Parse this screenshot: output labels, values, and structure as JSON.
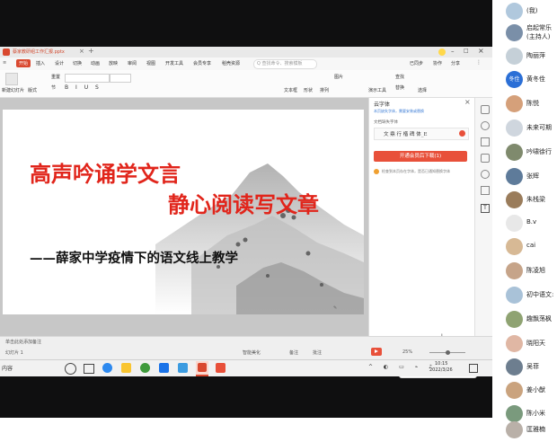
{
  "wps": {
    "doc_tab": "蔡家教研组工作汇报.pptx",
    "menu": [
      "开始",
      "插入",
      "设计",
      "切换",
      "动画",
      "放映",
      "审阅",
      "视图",
      "开发工具",
      "会员专享",
      "稻壳资源"
    ],
    "search_placeholder": "Q 查找命令、搜索模板",
    "menu_right": [
      "已同步",
      "协作",
      "分享"
    ],
    "toolbar_left": [
      "新建幻灯片",
      "版式",
      "重置",
      "节"
    ],
    "toolbar_right": [
      "文本框",
      "形状",
      "排列",
      "图片",
      "查找",
      "替换",
      "演示工具",
      "选择"
    ]
  },
  "slide": {
    "line1": "高声吟诵学文言",
    "line2": "静心阅读写文章",
    "line3": "——薛家中学疫情下的语文线上教学"
  },
  "panel": {
    "title": "云字体",
    "close": "×",
    "hint": "本页缺失字体，需要安装或替换",
    "label": "文档缺失字体",
    "font_name": "方正行楷繁体_E",
    "font_name_display": "文 鼎 行 楷 碑 体_E",
    "install_button": "开通会员后下载(1)",
    "warning": "检查到本页存在字体，是否已通知替换字体"
  },
  "statusbar": {
    "note": "单击此处添加备注",
    "left_label": "幻灯片 1",
    "smart_label": "智能美化",
    "remark_label": "备注",
    "comment_label": "批注",
    "zoom": "25%",
    "lang": "中"
  },
  "taskbar": {
    "search_text": "内容",
    "time": "10:15",
    "date": "2022/3/26"
  },
  "participants": [
    {
      "name": "(我)",
      "color": "#b0c8dd"
    },
    {
      "name": "启起常乐",
      "sub": "(主持人)",
      "color": "#7a8fa8"
    },
    {
      "name": "陶丽萍",
      "color": "#c5d0d8"
    },
    {
      "name": "黄冬佺",
      "color": "#2b6fd6",
      "text": "冬佺"
    },
    {
      "name": "陈悦",
      "color": "#d5a07a"
    },
    {
      "name": "未来可期",
      "color": "#cfd6de"
    },
    {
      "name": "吟啸徐行",
      "color": "#7f8a6d"
    },
    {
      "name": "张辉",
      "color": "#5e7b9a"
    },
    {
      "name": "朱栈梁",
      "color": "#9a7c5b"
    },
    {
      "name": "B.v",
      "color": "#e8e8e8"
    },
    {
      "name": "cai",
      "color": "#d7b995"
    },
    {
      "name": "陈凌旭",
      "color": "#c6a489"
    },
    {
      "name": "初中语文:",
      "color": "#a9c2d8"
    },
    {
      "name": "趣飘荡枫",
      "color": "#8fa372"
    },
    {
      "name": "晓阳天",
      "color": "#e0b7a4"
    },
    {
      "name": "吴菲",
      "color": "#6d7e8f"
    },
    {
      "name": "姜小猷",
      "color": "#caa37e"
    },
    {
      "name": "陈小米",
      "color": "#7a9a7d"
    },
    {
      "name": "匡雅楠",
      "color": "#b9b0a8"
    }
  ],
  "colors": {
    "accent": "#d9482f",
    "slide_title": "#e1251b",
    "install_button": "#e8503a"
  }
}
